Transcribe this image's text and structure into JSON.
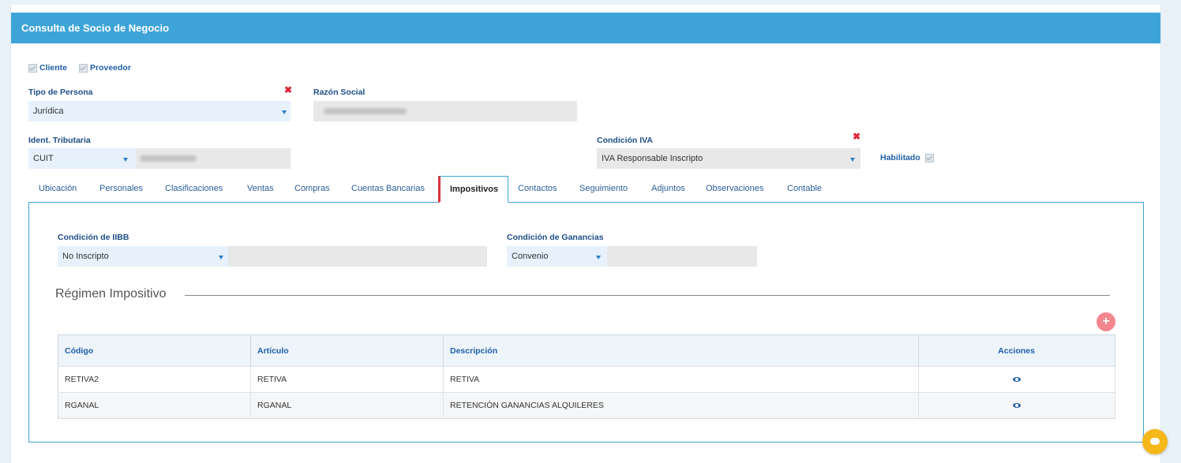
{
  "header": {
    "title": "Consulta de Socio de Negocio"
  },
  "checks": {
    "cliente": "Cliente",
    "proveedor": "Proveedor",
    "habilitado": "Habilitado"
  },
  "fields": {
    "tipo_persona": {
      "label": "Tipo de Persona",
      "value": "Jurídica"
    },
    "razon_social": {
      "label": "Razón Social"
    },
    "ident_tributaria": {
      "label": "Ident. Tributaria",
      "value": "CUIT"
    },
    "condicion_iva": {
      "label": "Condición IVA",
      "value": "IVA Responsable Inscripto"
    }
  },
  "tabs": [
    "Ubicación",
    "Personales",
    "Clasificaciones",
    "Ventas",
    "Compras",
    "Cuentas Bancarias",
    "Impositivos",
    "Contactos",
    "Seguimiento",
    "Adjuntos",
    "Observaciones",
    "Contable"
  ],
  "active_tab": "Impositivos",
  "impositivos": {
    "iibb": {
      "label": "Condición de IIBB",
      "value": "No Inscripto"
    },
    "ganancias": {
      "label": "Condición de Ganancias",
      "value": "Convenio"
    },
    "regimen_title": "Régimen Impositivo",
    "table": {
      "headers": [
        "Código",
        "Artículo",
        "Descripción",
        "Acciones"
      ],
      "rows": [
        [
          "RETIVA2",
          "RETIVA",
          "RETIVA"
        ],
        [
          "RGANAL",
          "RGANAL",
          "RETENCIÓN GANANCIAS ALQUILERES"
        ]
      ]
    }
  },
  "icons": {
    "add": "plus-circle-icon",
    "view": "eye-icon",
    "remove": "close-icon",
    "chat": "chat-bubble-icon"
  },
  "colors": {
    "header": "#3ea4d8",
    "accent": "#2e7cc4",
    "required": "#e0243a",
    "active_tab_marker": "#d8353f"
  }
}
